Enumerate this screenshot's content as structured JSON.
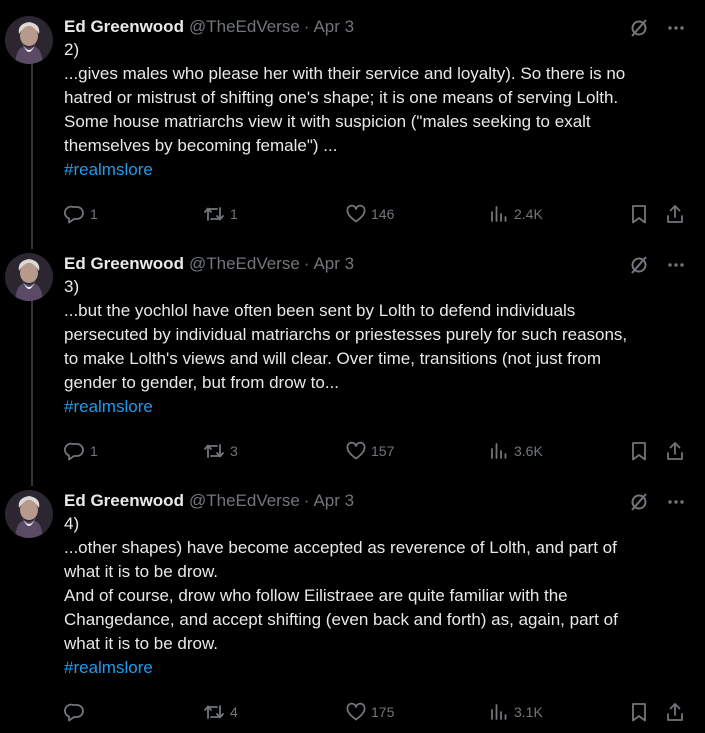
{
  "tweets": [
    {
      "author": "Ed Greenwood",
      "handle": "@TheEdVerse",
      "separator": "·",
      "date": "Apr 3",
      "lines": [
        "2)",
        "...gives males who please her with their service and loyalty). So there is no",
        "hatred or mistrust of shifting one's shape; it is one means of serving Lolth.",
        "Some house matriarchs view it with suspicion (\"males seeking to exalt",
        "themselves by becoming female\") ..."
      ],
      "hashtag": "#realmslore",
      "replies": "1",
      "reposts": "1",
      "likes": "146",
      "views": "2.4K"
    },
    {
      "author": "Ed Greenwood",
      "handle": "@TheEdVerse",
      "separator": "·",
      "date": "Apr 3",
      "lines": [
        "3)",
        "...but the yochlol have often been sent by Lolth to defend individuals",
        "persecuted by individual matriarchs or priestesses purely for such reasons,",
        "to make Lolth's views and will clear. Over time, transitions (not just from",
        "gender to gender, but from drow to..."
      ],
      "hashtag": "#realmslore",
      "replies": "1",
      "reposts": "3",
      "likes": "157",
      "views": "3.6K"
    },
    {
      "author": "Ed Greenwood",
      "handle": "@TheEdVerse",
      "separator": "·",
      "date": "Apr 3",
      "lines": [
        "4)",
        "...other shapes) have become accepted as reverence of Lolth, and part of",
        "what it is to be drow.",
        "And of course, drow who follow Eilistraee are quite familiar with the",
        "Changedance, and accept shifting (even back and forth) as, again, part of",
        "what it is to be drow."
      ],
      "hashtag": "#realmslore",
      "replies": "",
      "reposts": "4",
      "likes": "175",
      "views": "3.1K"
    }
  ],
  "colors": {
    "background": "#000000",
    "text": "#e7e9ea",
    "muted": "#71767b",
    "link": "#1d9bf0",
    "thread_line": "#333639"
  },
  "icons": [
    "grok-icon",
    "more-icon",
    "reply-icon",
    "repost-icon",
    "like-icon",
    "views-icon",
    "bookmark-icon",
    "share-icon"
  ]
}
